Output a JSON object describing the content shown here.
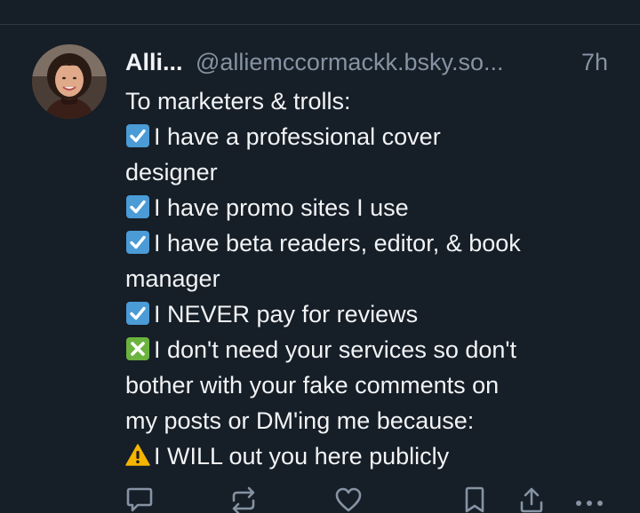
{
  "post": {
    "author": {
      "display_name": "Alli...",
      "handle": "@alliemccormackk.bsky.so..."
    },
    "timestamp": "7h",
    "lines": [
      {
        "emoji": "",
        "text": "To marketers & trolls:"
      },
      {
        "emoji": "check-box-icon",
        "text": "I have a professional cover"
      },
      {
        "emoji": "",
        "text": "designer"
      },
      {
        "emoji": "check-box-icon",
        "text": "I have promo sites I use"
      },
      {
        "emoji": "check-box-icon",
        "text": "I have beta readers, editor, & book"
      },
      {
        "emoji": "",
        "text": "manager"
      },
      {
        "emoji": "check-box-icon",
        "text": "I NEVER pay for reviews"
      },
      {
        "emoji": "cross-mark-icon",
        "text": "I don't need your services so don't"
      },
      {
        "emoji": "",
        "text": "bother with your fake comments on"
      },
      {
        "emoji": "",
        "text": "my posts or DM'ing me because:"
      },
      {
        "emoji": "warning-icon",
        "text": "I WILL out you here publicly"
      }
    ],
    "actions": [
      "reply-icon",
      "repost-icon",
      "like-icon",
      "bookmark-icon",
      "share-icon",
      "more-icon"
    ]
  },
  "colors": {
    "background": "#161e27",
    "text": "#f1f3f5",
    "muted": "#8593a3",
    "check_box": "#4a9bd6",
    "cross_box": "#6bb33f",
    "warning": "#f5b400"
  }
}
